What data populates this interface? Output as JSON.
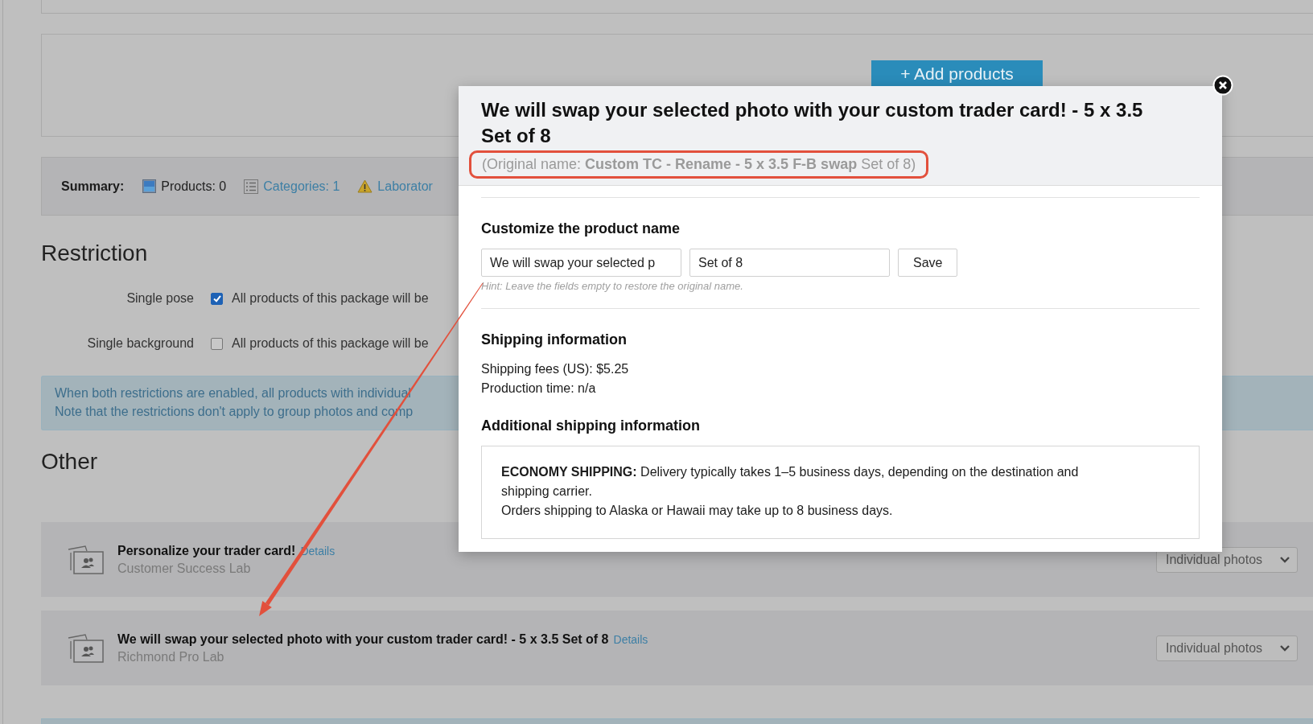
{
  "page": {
    "add_products_button": "+ Add products",
    "summary": {
      "label": "Summary:",
      "items": [
        {
          "kind": "count",
          "text": "Products: 0"
        },
        {
          "kind": "link",
          "text": "Categories: 1"
        },
        {
          "kind": "warning",
          "text": "Laborator"
        }
      ]
    },
    "restriction": {
      "heading": "Restriction",
      "options": [
        {
          "label": "Single pose",
          "checked": true,
          "text": "All products of this package will be"
        },
        {
          "label": "Single background",
          "checked": false,
          "text": "All products of this package will be"
        }
      ],
      "info": [
        "When both restrictions are enabled, all products with individual",
        "Note that the restrictions don't apply to group photos and comp"
      ]
    },
    "other": {
      "heading": "Other",
      "products": [
        {
          "title": "Personalize your trader card!",
          "link": "Details",
          "lab": "Customer Success Lab",
          "mode": "Individual photos"
        },
        {
          "title": "We will swap your selected photo with your custom trader card! - 5 x 3.5 Set of 8",
          "link": "Details",
          "lab": "Richmond Pro Lab",
          "mode": "Individual photos"
        }
      ]
    }
  },
  "modal": {
    "title": "We will swap your selected photo with your custom trader card! - 5 x 3.5 Set of 8",
    "original_name": "(Original name: **Custom TC - Rename - 5 x 3.5 F-B swap** Set of 8)",
    "customize": {
      "heading": "Customize the product name",
      "name_value": "We will swap your selected p",
      "suffix_value": "Set of 8",
      "save_button": "Save",
      "hint": "Hint: Leave the fields empty to restore the original name."
    },
    "shipping": {
      "heading": "Shipping information",
      "lines": [
        "Shipping fees (US): $5.25",
        "Production time: n/a"
      ]
    },
    "additional": {
      "heading": "Additional shipping information",
      "text": "**ECONOMY SHIPPING:** Delivery typically takes 1–5 business days, depending on the destination and shipping carrier.",
      "note": "Orders shipping to Alaska or Hawaii may take up to 8 business days."
    }
  }
}
